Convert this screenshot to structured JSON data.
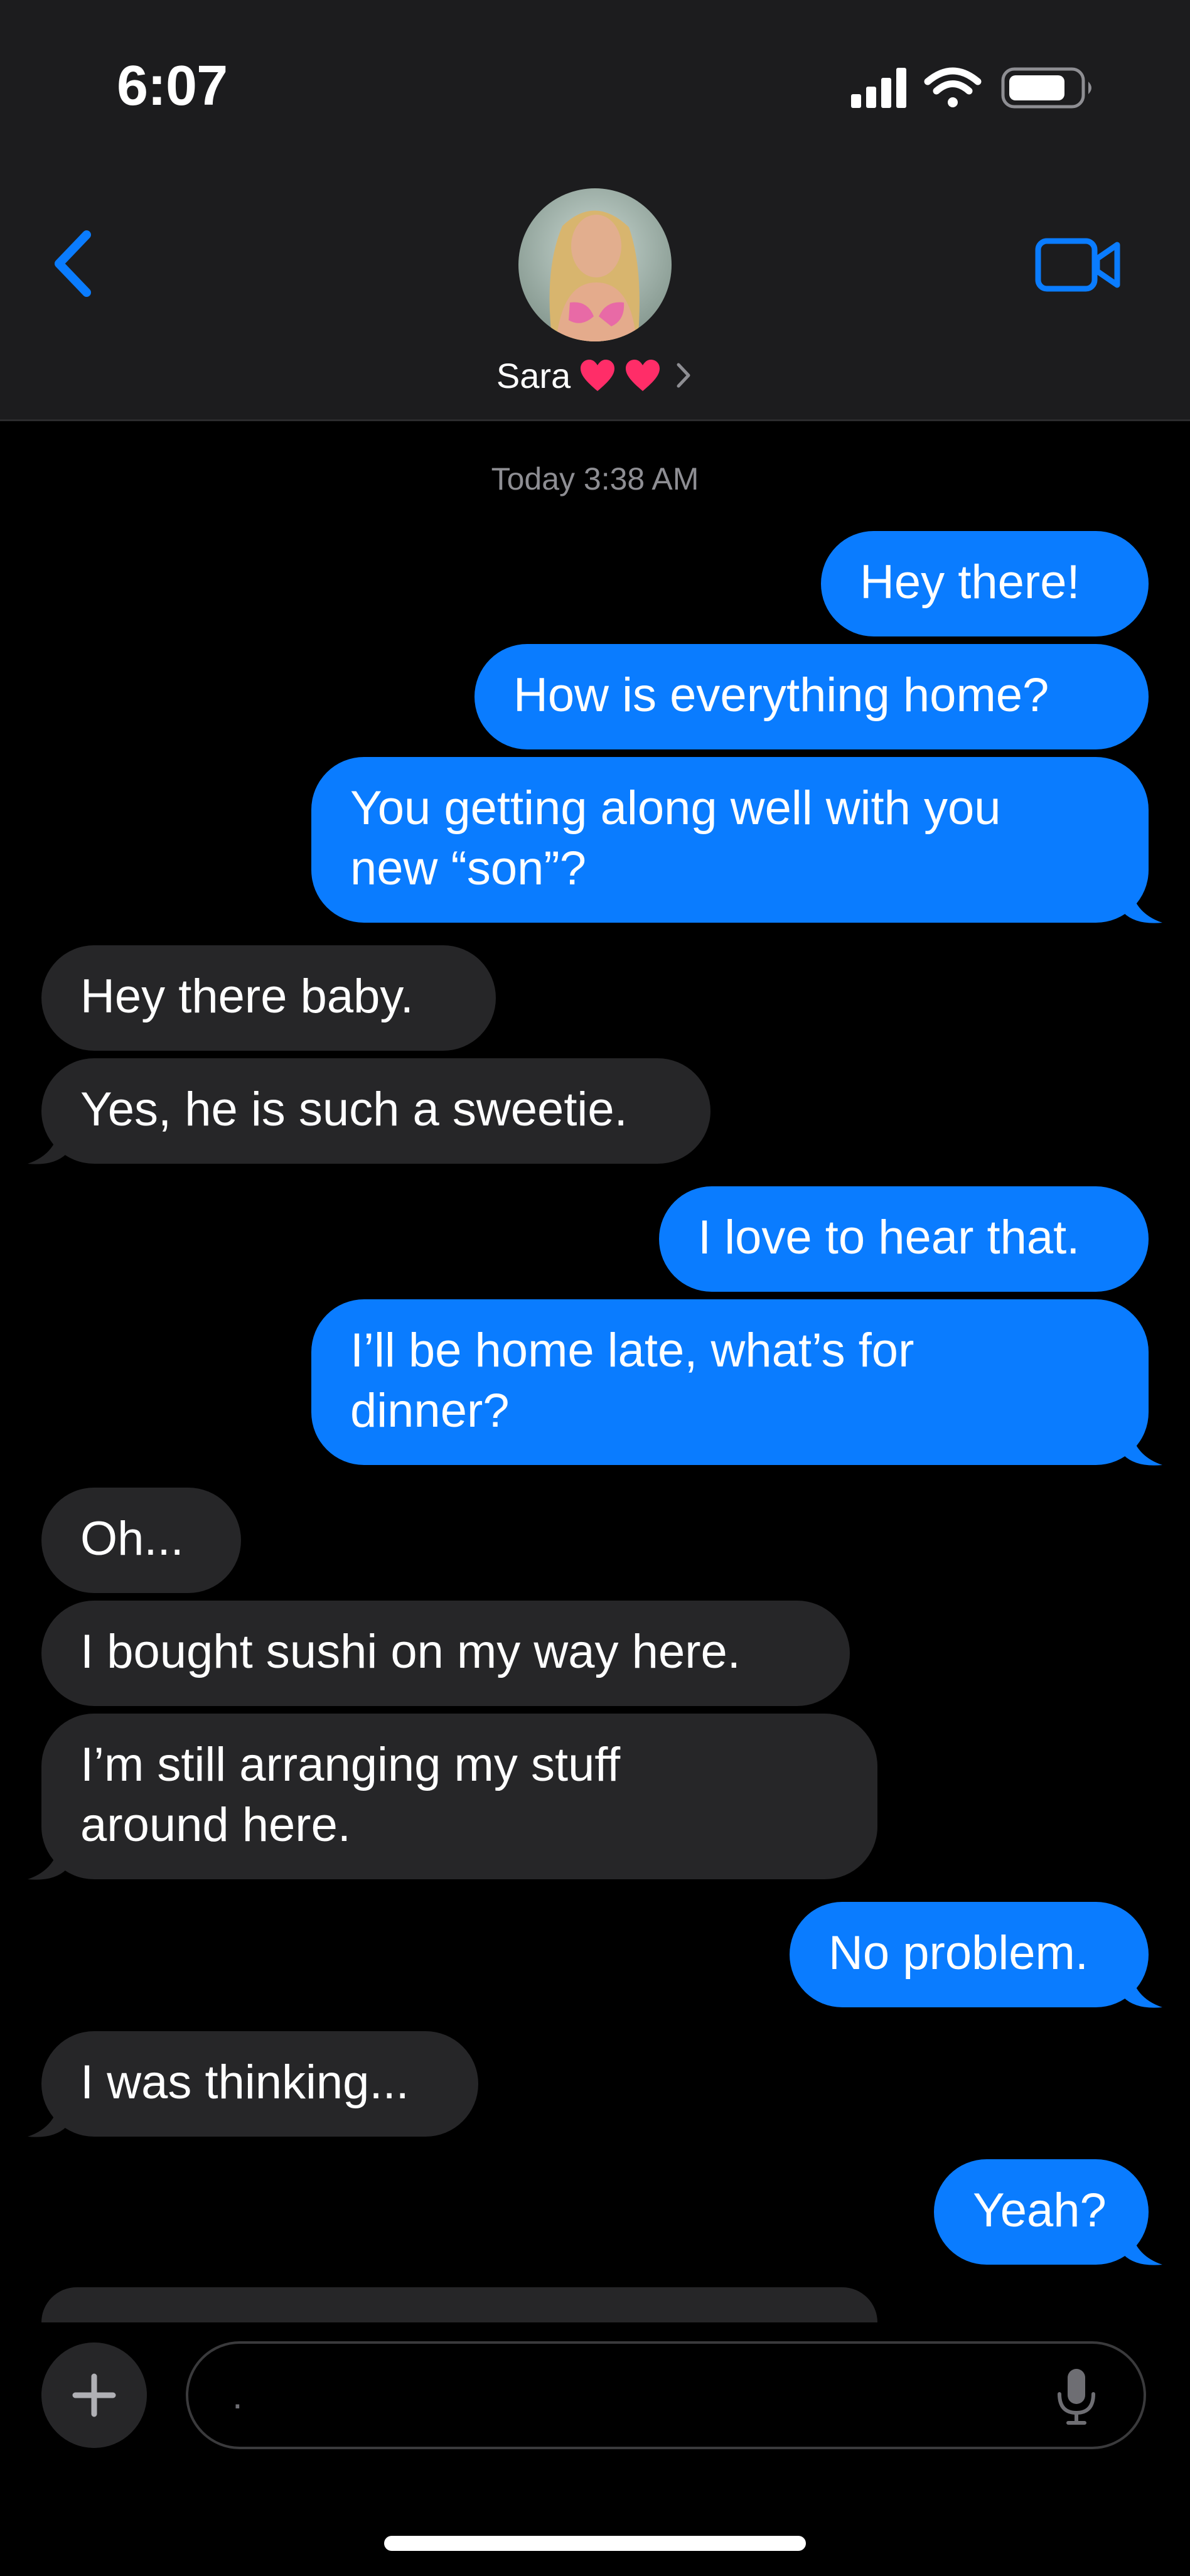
{
  "status_bar": {
    "time": "6:07"
  },
  "header": {
    "contact_name": "Sara",
    "accent_color": "#0a7cff",
    "icons": [
      "back-chevron-icon",
      "avatar",
      "heart-icon",
      "heart-icon",
      "chevron-right-icon",
      "video-camera-icon"
    ]
  },
  "conversation": {
    "timestamp": "Today 3:38 AM",
    "messages": [
      {
        "direction": "outgoing",
        "text": "Hey there!"
      },
      {
        "direction": "outgoing",
        "text": "How is everything home?"
      },
      {
        "direction": "outgoing",
        "text": "You getting along well with you\nnew “son”?"
      },
      {
        "direction": "incoming",
        "text": "Hey there baby."
      },
      {
        "direction": "incoming",
        "text": "Yes, he is such a sweetie."
      },
      {
        "direction": "outgoing",
        "text": "I love to hear that."
      },
      {
        "direction": "outgoing",
        "text": "I’ll be home late, what’s for\ndinner?"
      },
      {
        "direction": "incoming",
        "text": "Oh..."
      },
      {
        "direction": "incoming",
        "text": "I bought sushi on my way here."
      },
      {
        "direction": "incoming",
        "text": "I’m still arranging my stuff\naround here."
      },
      {
        "direction": "outgoing",
        "text": "No problem."
      },
      {
        "direction": "incoming",
        "text": "I was thinking..."
      },
      {
        "direction": "outgoing",
        "text": "Yeah?"
      }
    ]
  },
  "composer": {
    "placeholder": ".",
    "value": ""
  },
  "colors": {
    "outgoing_bubble": "#0a7cff",
    "incoming_bubble": "#262628",
    "background": "#000000",
    "header_background": "#1c1c1e"
  }
}
